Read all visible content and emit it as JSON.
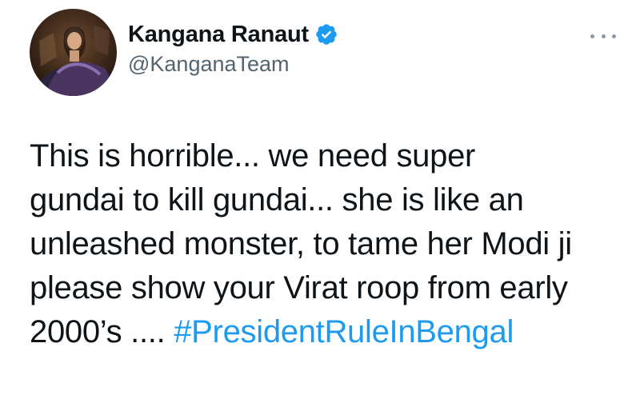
{
  "author": {
    "display_name": "Kangana Ranaut",
    "handle": "@KanganaTeam",
    "verified": true,
    "avatar_icon": "profile-photo"
  },
  "menu": {
    "icon": "more-options-icon"
  },
  "tweet": {
    "lines": [
      "This is horrible... we need super",
      "gundai to kill gundai... she is like an",
      "unleashed monster, to tame her Modi ji",
      "please show your Virat roop from early"
    ],
    "last_line_prefix": "2000’s .... ",
    "hashtag": "#PresidentRuleInBengal"
  },
  "colors": {
    "text": "#0f1419",
    "secondary": "#536471",
    "link": "#1d9bf0",
    "verified_badge": "#1d9bf0"
  }
}
